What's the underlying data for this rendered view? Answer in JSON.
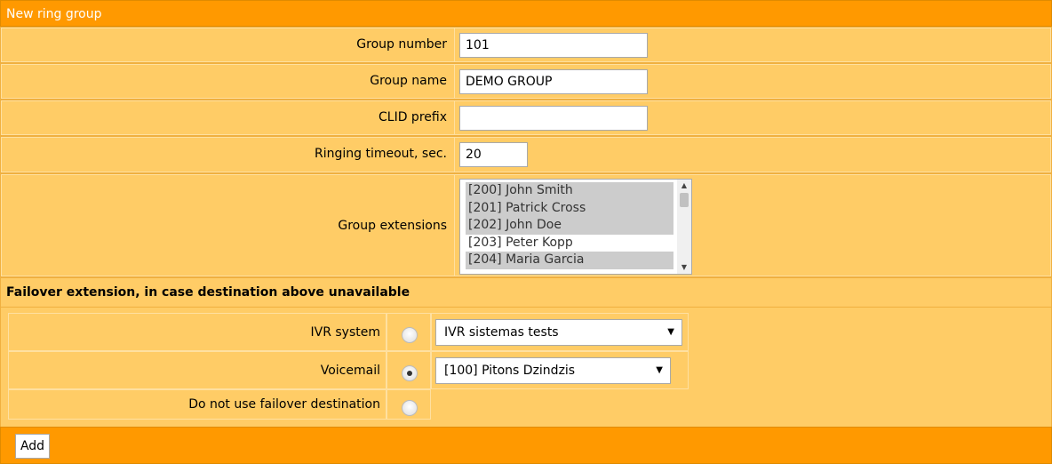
{
  "header": {
    "title": "New ring group"
  },
  "form": {
    "group_number": {
      "label": "Group number",
      "value": "101"
    },
    "group_name": {
      "label": "Group name",
      "value": "DEMO GROUP"
    },
    "clid_prefix": {
      "label": "CLID prefix",
      "value": ""
    },
    "ringing_timeout": {
      "label": "Ringing timeout, sec.",
      "value": "20"
    },
    "group_extensions": {
      "label": "Group extensions",
      "options": [
        {
          "text": "[200] John Smith",
          "selected": true
        },
        {
          "text": "[201] Patrick Cross",
          "selected": true
        },
        {
          "text": "[202] John Doe",
          "selected": true
        },
        {
          "text": "[203] Peter Kopp",
          "selected": false
        },
        {
          "text": "[204] Maria Garcia",
          "selected": true
        }
      ]
    }
  },
  "failover": {
    "heading": "Failover extension, in case destination above unavailable",
    "options": [
      {
        "label": "IVR system",
        "checked": false,
        "select_value": "IVR sistemas tests"
      },
      {
        "label": "Voicemail",
        "checked": true,
        "select_value": "[100] Pitons Dzindzis"
      },
      {
        "label": "Do not use failover destination",
        "checked": false
      }
    ]
  },
  "footer": {
    "add_label": "Add"
  },
  "colors": {
    "header_bg": "#ff9900",
    "row_bg": "#ffcc66",
    "selected_option_bg": "#cccccc"
  }
}
